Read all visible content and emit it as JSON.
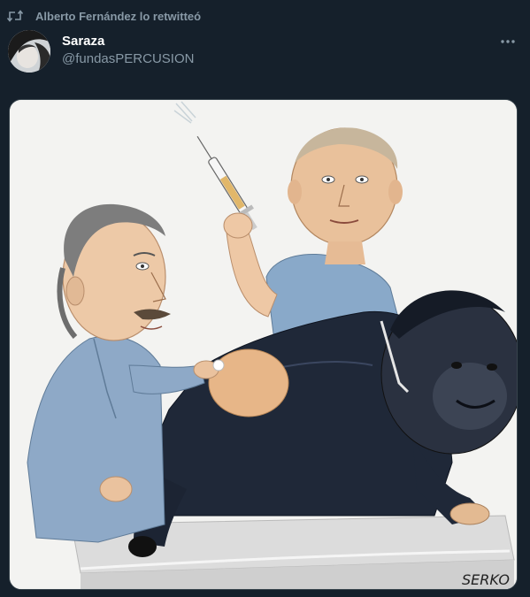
{
  "retweet": {
    "icon": "retweet-icon",
    "text": "Alberto Fernández lo retwitteó"
  },
  "author": {
    "name": "Saraza",
    "handle": "@fundasPERCUSION"
  },
  "menu": {
    "icon": "more-horizontal-icon"
  },
  "media": {
    "signature": "SERKO"
  },
  "colors": {
    "background": "#15202b",
    "secondary_text": "#8899a6",
    "primary_text": "#ffffff"
  }
}
